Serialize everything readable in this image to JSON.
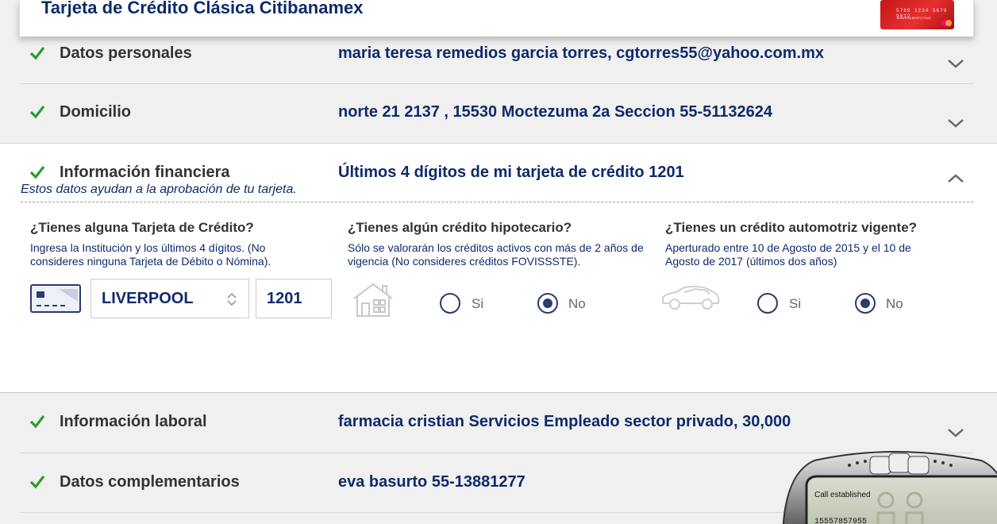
{
  "header": {
    "title": "Tarjeta de Crédito Clásica Citibanamex",
    "card_number": "5769 1234 5678 9012",
    "card_name": "JAVIER ALBERTO RUIZ"
  },
  "sections": {
    "datos_personales": {
      "label": "Datos personales",
      "value": "maria teresa remedios garcia torres, cgtorres55@yahoo.com.mx",
      "complete": true
    },
    "domicilio": {
      "label": "Domicilio",
      "value": "norte 21 2137 , 15530 Moctezuma 2a Seccion 55-51132624",
      "complete": true
    },
    "financiera": {
      "label": "Información financiera",
      "value": "Últimos 4 dígitos de mi tarjeta de crédito 1201",
      "help": "Estos datos ayudan a la aprobación de tu tarjeta.",
      "complete": true,
      "credit_card": {
        "title": "¿Tienes alguna Tarjeta de Crédito?",
        "desc": "Ingresa la Institución y los últimos 4 dígitos. (No consideres ninguna Tarjeta de Débito o Nómina).",
        "institution": "LIVERPOOL",
        "last4": "1201"
      },
      "mortgage": {
        "title": "¿Tienes algún crédito hipotecario?",
        "desc": "Sólo se valorarán los créditos activos con más de 2 años de vigencia (No consideres créditos FOVISSSTE).",
        "yes_label": "Si",
        "no_label": "No",
        "selected": "No"
      },
      "auto": {
        "title": "¿Tienes un crédito automotriz vigente?",
        "desc": "Aperturado entre 10 de Agosto de 2015 y el 10 de Agosto de 2017 (últimos dos años)",
        "yes_label": "Si",
        "no_label": "No",
        "selected": "No"
      }
    },
    "laboral": {
      "label": "Información laboral",
      "value": "farmacia cristian Servicios Empleado sector privado, 30,000",
      "complete": true
    },
    "complementarios": {
      "label": "Datos complementarios",
      "value": "eva basurto 55-13881277",
      "complete": true
    }
  },
  "softphone": {
    "status": "Call established",
    "number": "15557857955"
  },
  "colors": {
    "navy": "#0f2a6b",
    "check": "#2a9d2a",
    "radio": "#2b3a70"
  }
}
